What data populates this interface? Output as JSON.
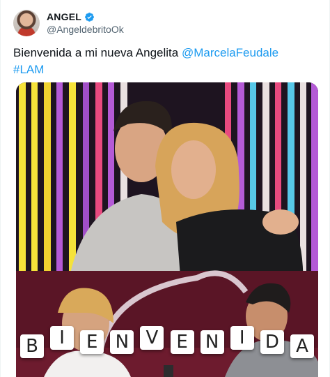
{
  "tweet": {
    "author": {
      "display_name": "ANGEL",
      "handle": "@AngeldebritoOk",
      "verified_icon": "verified-badge-icon",
      "avatar": "profile-avatar"
    },
    "text": {
      "main": "Bienvenida a mi nueva Angelita ",
      "mention": "@MarcelaFeudale",
      "hashtag": "#LAM"
    },
    "media": {
      "banner_letters": [
        "B",
        "I",
        "E",
        "N",
        "V",
        "E",
        "N",
        "I",
        "D",
        "A"
      ],
      "colors": {
        "accent": "#1d9bf0",
        "stripes": [
          "#f5e23a",
          "#b45ad6",
          "#e84a7f",
          "#57c7e8",
          "#e9e0e0"
        ]
      }
    }
  }
}
